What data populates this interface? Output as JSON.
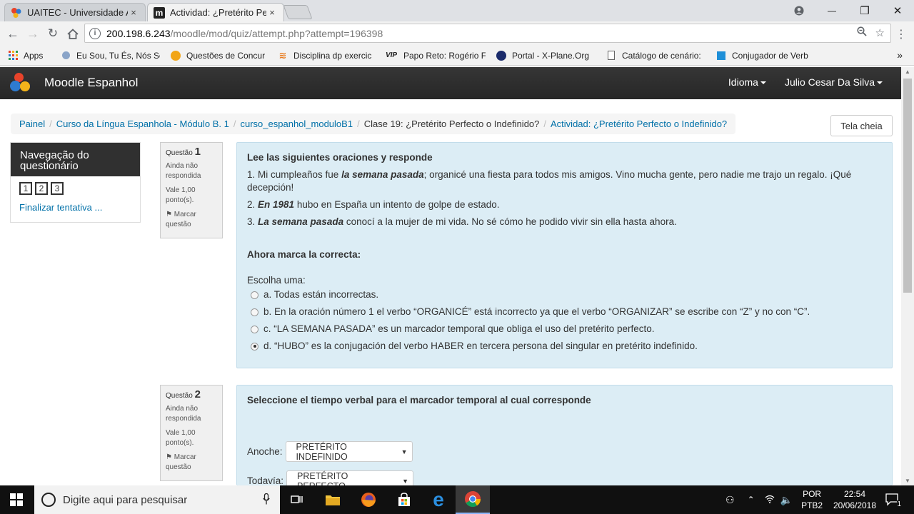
{
  "browser": {
    "tabs": [
      {
        "title": "UAITEC - Universidade Al",
        "close": "×"
      },
      {
        "title": "Actividad: ¿Pretérito Perfe",
        "close": "×"
      }
    ],
    "window_controls": {
      "minimize": "—",
      "maximize": "❐",
      "close": "✕"
    },
    "url_host": "200.198.6.243",
    "url_path": "/moodle/mod/quiz/attempt.php?attempt=196398",
    "bookmarks": [
      {
        "label": "Apps",
        "icon": "apps-grid-icon"
      },
      {
        "label": "Eu Sou, Tu És, Nós So",
        "icon": "bookmark-favicon"
      },
      {
        "label": "Questões de Concur",
        "icon": "bookmark-favicon"
      },
      {
        "label": "Disciplina dp exercic",
        "icon": "bookmark-favicon"
      },
      {
        "label": "Papo Reto: Rogério F",
        "icon": "vip-icon"
      },
      {
        "label": "Portal - X-Plane.Org",
        "icon": "bookmark-favicon"
      },
      {
        "label": "Catálogo de cenário:",
        "icon": "page-icon"
      },
      {
        "label": "Conjugador de Verb",
        "icon": "bookmark-favicon"
      }
    ],
    "bookmark_vip_text": "VIP",
    "more_bookmarks": "»"
  },
  "navbar": {
    "brand": "Moodle Espanhol",
    "language_menu": "Idioma",
    "user_menu": "Julio Cesar Da Silva"
  },
  "breadcrumb": {
    "items": [
      "Painel",
      "Curso da Língua Espanhola - Módulo B. 1",
      "curso_espanhol_moduloB1",
      "Clase 19: ¿Pretérito Perfecto o Indefinido?",
      "Actividad: ¿Pretérito Perfecto o Indefinido?"
    ],
    "separator": "/"
  },
  "fullscreen_button": "Tela cheia",
  "quiz_nav": {
    "title": "Navegação do questionário",
    "questions": [
      "1",
      "2",
      "3"
    ],
    "finish_link": "Finalizar tentativa ..."
  },
  "questions": [
    {
      "label": "Questão",
      "number": "1",
      "state": "Ainda não respondida",
      "grade": "Vale 1,00 ponto(s).",
      "flag": "Marcar questão",
      "title": "Lee las siguientes oraciones y responde",
      "sentences": [
        {
          "pre": "1. Mi cumpleaños fue ",
          "em": "la semana pasada",
          "post": "; organicé una fiesta para todos mis amigos. Vino mucha gente, pero nadie me trajo un regalo. ¡Qué decepción!"
        },
        {
          "pre": "2. ",
          "em": "En 1981",
          "post": " hubo en España un intento de golpe de estado."
        },
        {
          "pre": "3. ",
          "em": "La semana pasada",
          "post": " conocí a la mujer de mi vida. No sé cómo he podido vivir sin ella hasta ahora."
        }
      ],
      "prompt": "Ahora marca la correcta:",
      "choose_label": "Escolha uma:",
      "options": [
        {
          "text": "a. Todas están incorrectas.",
          "selected": false
        },
        {
          "text": "b. En la oración número 1 el verbo “ORGANICÉ” está incorrecto ya que el verbo “ORGANIZAR” se escribe con “Z” y no con “C”.",
          "selected": false
        },
        {
          "text": "c. “LA SEMANA PASADA” es un marcador temporal que obliga el uso del pretérito perfecto.",
          "selected": false
        },
        {
          "text": "d. “HUBO” es la conjugación del verbo HABER en tercera persona del singular en pretérito indefinido.",
          "selected": true
        }
      ]
    },
    {
      "label": "Questão",
      "number": "2",
      "state": "Ainda não respondida",
      "grade": "Vale 1,00 ponto(s).",
      "flag": "Marcar questão",
      "title": "Seleccione el tiempo verbal para el marcador temporal al cual corresponde",
      "matches": [
        {
          "label": "Anoche:",
          "value": "PRETÉRITO INDEFINIDO"
        },
        {
          "label": "Todavía:",
          "value": "PRETÉRITO PERFECTO"
        }
      ]
    }
  ],
  "taskbar": {
    "search_placeholder": "Digite aqui para pesquisar",
    "language": "POR",
    "layout": "PTB2",
    "time": "22:54",
    "date": "20/06/2018",
    "notifications": "1"
  },
  "colors": {
    "link": "#0070a8",
    "question_bg": "#dcedf5",
    "navbar_bg": "#2f2f2f"
  }
}
